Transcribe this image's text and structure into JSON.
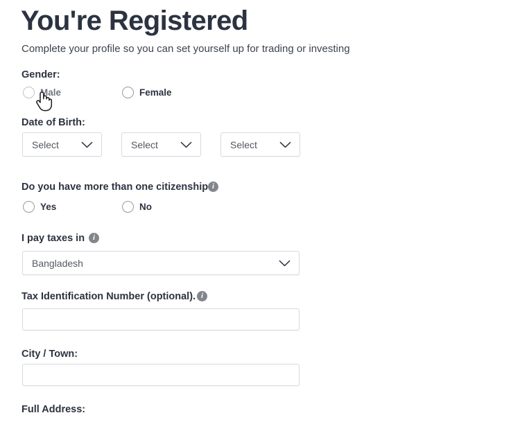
{
  "header": {
    "title": "You're Registered",
    "subtitle": "Complete your profile so you can set yourself up for trading or investing"
  },
  "form": {
    "gender": {
      "label": "Gender:",
      "options": [
        {
          "label": "Male",
          "selected": false,
          "hovered": true
        },
        {
          "label": "Female",
          "selected": false,
          "hovered": false
        }
      ]
    },
    "date_of_birth": {
      "label": "Date of Birth:",
      "selects": [
        {
          "name": "day",
          "value": "Select"
        },
        {
          "name": "month",
          "value": "Select"
        },
        {
          "name": "year",
          "value": "Select"
        }
      ]
    },
    "citizenship": {
      "label": "Do you have more than one citizenship?",
      "info_icon": "info-icon",
      "options": [
        {
          "label": "Yes",
          "selected": false
        },
        {
          "label": "No",
          "selected": false
        }
      ]
    },
    "tax_country": {
      "label": "I pay taxes in",
      "info_icon": "info-icon",
      "value": "Bangladesh"
    },
    "tax_id": {
      "label": "Tax Identification Number (optional).",
      "info_icon": "info-icon",
      "value": "",
      "placeholder": ""
    },
    "city": {
      "label": "City / Town:",
      "value": "",
      "placeholder": ""
    },
    "address": {
      "label": "Full Address:"
    }
  },
  "icons": {
    "chevron_down": "chevron-down-icon",
    "cursor": "pointer-hand-cursor"
  },
  "colors": {
    "heading": "#2c3340",
    "body_text": "#3c434e",
    "field_border": "#d8dadd",
    "info_icon_bg": "#82868c",
    "background": "#ffffff"
  }
}
